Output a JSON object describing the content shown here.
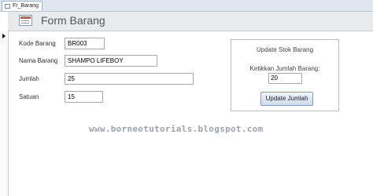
{
  "tab": {
    "label": "Fr_Barang"
  },
  "form": {
    "title": "Form Barang"
  },
  "fields": [
    {
      "label": "Kode Barang",
      "value": "BR003"
    },
    {
      "label": "Nama Barang",
      "value": "SHAMPO LIFEBOY"
    },
    {
      "label": "Jumlah",
      "value": "25"
    },
    {
      "label": "Satuan",
      "value": "15"
    }
  ],
  "update_panel": {
    "title": "Update Stok Barang",
    "prompt": "Ketikkan Jumlah Barang:",
    "input_value": "20",
    "button_label": "Update Jumlah"
  },
  "watermark": "www.borneotutorials.blogspot.com"
}
